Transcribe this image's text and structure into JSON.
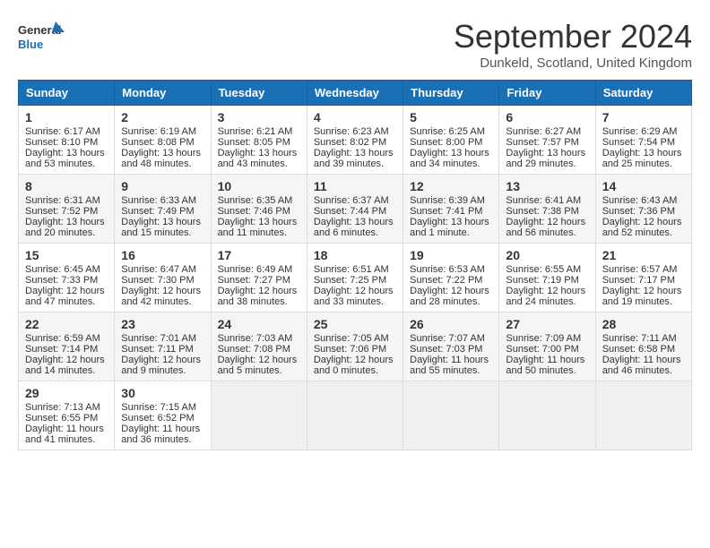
{
  "logo": {
    "line1": "General",
    "line2": "Blue"
  },
  "title": "September 2024",
  "location": "Dunkeld, Scotland, United Kingdom",
  "days_of_week": [
    "Sunday",
    "Monday",
    "Tuesday",
    "Wednesday",
    "Thursday",
    "Friday",
    "Saturday"
  ],
  "weeks": [
    [
      {
        "day": "1",
        "lines": [
          "Sunrise: 6:17 AM",
          "Sunset: 8:10 PM",
          "Daylight: 13 hours",
          "and 53 minutes."
        ]
      },
      {
        "day": "2",
        "lines": [
          "Sunrise: 6:19 AM",
          "Sunset: 8:08 PM",
          "Daylight: 13 hours",
          "and 48 minutes."
        ]
      },
      {
        "day": "3",
        "lines": [
          "Sunrise: 6:21 AM",
          "Sunset: 8:05 PM",
          "Daylight: 13 hours",
          "and 43 minutes."
        ]
      },
      {
        "day": "4",
        "lines": [
          "Sunrise: 6:23 AM",
          "Sunset: 8:02 PM",
          "Daylight: 13 hours",
          "and 39 minutes."
        ]
      },
      {
        "day": "5",
        "lines": [
          "Sunrise: 6:25 AM",
          "Sunset: 8:00 PM",
          "Daylight: 13 hours",
          "and 34 minutes."
        ]
      },
      {
        "day": "6",
        "lines": [
          "Sunrise: 6:27 AM",
          "Sunset: 7:57 PM",
          "Daylight: 13 hours",
          "and 29 minutes."
        ]
      },
      {
        "day": "7",
        "lines": [
          "Sunrise: 6:29 AM",
          "Sunset: 7:54 PM",
          "Daylight: 13 hours",
          "and 25 minutes."
        ]
      }
    ],
    [
      {
        "day": "8",
        "lines": [
          "Sunrise: 6:31 AM",
          "Sunset: 7:52 PM",
          "Daylight: 13 hours",
          "and 20 minutes."
        ]
      },
      {
        "day": "9",
        "lines": [
          "Sunrise: 6:33 AM",
          "Sunset: 7:49 PM",
          "Daylight: 13 hours",
          "and 15 minutes."
        ]
      },
      {
        "day": "10",
        "lines": [
          "Sunrise: 6:35 AM",
          "Sunset: 7:46 PM",
          "Daylight: 13 hours",
          "and 11 minutes."
        ]
      },
      {
        "day": "11",
        "lines": [
          "Sunrise: 6:37 AM",
          "Sunset: 7:44 PM",
          "Daylight: 13 hours",
          "and 6 minutes."
        ]
      },
      {
        "day": "12",
        "lines": [
          "Sunrise: 6:39 AM",
          "Sunset: 7:41 PM",
          "Daylight: 13 hours",
          "and 1 minute."
        ]
      },
      {
        "day": "13",
        "lines": [
          "Sunrise: 6:41 AM",
          "Sunset: 7:38 PM",
          "Daylight: 12 hours",
          "and 56 minutes."
        ]
      },
      {
        "day": "14",
        "lines": [
          "Sunrise: 6:43 AM",
          "Sunset: 7:36 PM",
          "Daylight: 12 hours",
          "and 52 minutes."
        ]
      }
    ],
    [
      {
        "day": "15",
        "lines": [
          "Sunrise: 6:45 AM",
          "Sunset: 7:33 PM",
          "Daylight: 12 hours",
          "and 47 minutes."
        ]
      },
      {
        "day": "16",
        "lines": [
          "Sunrise: 6:47 AM",
          "Sunset: 7:30 PM",
          "Daylight: 12 hours",
          "and 42 minutes."
        ]
      },
      {
        "day": "17",
        "lines": [
          "Sunrise: 6:49 AM",
          "Sunset: 7:27 PM",
          "Daylight: 12 hours",
          "and 38 minutes."
        ]
      },
      {
        "day": "18",
        "lines": [
          "Sunrise: 6:51 AM",
          "Sunset: 7:25 PM",
          "Daylight: 12 hours",
          "and 33 minutes."
        ]
      },
      {
        "day": "19",
        "lines": [
          "Sunrise: 6:53 AM",
          "Sunset: 7:22 PM",
          "Daylight: 12 hours",
          "and 28 minutes."
        ]
      },
      {
        "day": "20",
        "lines": [
          "Sunrise: 6:55 AM",
          "Sunset: 7:19 PM",
          "Daylight: 12 hours",
          "and 24 minutes."
        ]
      },
      {
        "day": "21",
        "lines": [
          "Sunrise: 6:57 AM",
          "Sunset: 7:17 PM",
          "Daylight: 12 hours",
          "and 19 minutes."
        ]
      }
    ],
    [
      {
        "day": "22",
        "lines": [
          "Sunrise: 6:59 AM",
          "Sunset: 7:14 PM",
          "Daylight: 12 hours",
          "and 14 minutes."
        ]
      },
      {
        "day": "23",
        "lines": [
          "Sunrise: 7:01 AM",
          "Sunset: 7:11 PM",
          "Daylight: 12 hours",
          "and 9 minutes."
        ]
      },
      {
        "day": "24",
        "lines": [
          "Sunrise: 7:03 AM",
          "Sunset: 7:08 PM",
          "Daylight: 12 hours",
          "and 5 minutes."
        ]
      },
      {
        "day": "25",
        "lines": [
          "Sunrise: 7:05 AM",
          "Sunset: 7:06 PM",
          "Daylight: 12 hours",
          "and 0 minutes."
        ]
      },
      {
        "day": "26",
        "lines": [
          "Sunrise: 7:07 AM",
          "Sunset: 7:03 PM",
          "Daylight: 11 hours",
          "and 55 minutes."
        ]
      },
      {
        "day": "27",
        "lines": [
          "Sunrise: 7:09 AM",
          "Sunset: 7:00 PM",
          "Daylight: 11 hours",
          "and 50 minutes."
        ]
      },
      {
        "day": "28",
        "lines": [
          "Sunrise: 7:11 AM",
          "Sunset: 6:58 PM",
          "Daylight: 11 hours",
          "and 46 minutes."
        ]
      }
    ],
    [
      {
        "day": "29",
        "lines": [
          "Sunrise: 7:13 AM",
          "Sunset: 6:55 PM",
          "Daylight: 11 hours",
          "and 41 minutes."
        ]
      },
      {
        "day": "30",
        "lines": [
          "Sunrise: 7:15 AM",
          "Sunset: 6:52 PM",
          "Daylight: 11 hours",
          "and 36 minutes."
        ]
      },
      {
        "day": "",
        "lines": []
      },
      {
        "day": "",
        "lines": []
      },
      {
        "day": "",
        "lines": []
      },
      {
        "day": "",
        "lines": []
      },
      {
        "day": "",
        "lines": []
      }
    ]
  ]
}
